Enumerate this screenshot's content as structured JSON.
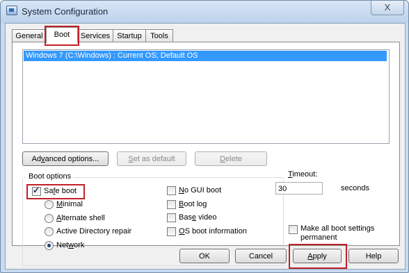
{
  "window": {
    "title": "System Configuration",
    "close_glyph": "X",
    "icon": "system-config-icon"
  },
  "tabs": [
    {
      "label": "General"
    },
    {
      "label": "Boot",
      "active": true
    },
    {
      "label": "Services"
    },
    {
      "label": "Startup"
    },
    {
      "label": "Tools"
    }
  ],
  "os_list": {
    "items": [
      "Windows 7 (C:\\Windows) : Current OS; Default OS"
    ],
    "selected_index": 0
  },
  "list_buttons": {
    "advanced_options": "Advanced options...",
    "set_default": "Set as default",
    "delete": "Delete"
  },
  "boot_options": {
    "label": "Boot options",
    "safe_boot": {
      "label": "Safe boot",
      "checked": true
    },
    "radios": {
      "minimal": "Minimal",
      "alternate_shell": "Alternate shell",
      "ad_repair": "Active Directory repair",
      "network": "Network",
      "selected": "Network"
    },
    "no_gui_boot": {
      "label": "No GUI boot",
      "checked": false
    },
    "boot_log": {
      "label": "Boot log",
      "checked": false
    },
    "base_video": {
      "label": "Base video",
      "checked": false
    },
    "os_boot_info": {
      "label": "OS boot information",
      "checked": false
    }
  },
  "timeout": {
    "label": "Timeout:",
    "value": "30",
    "unit": "seconds"
  },
  "permanent": {
    "label_line1": "Make all boot settings",
    "label_line2": "permanent",
    "checked": false
  },
  "dialog_buttons": {
    "ok": "OK",
    "cancel": "Cancel",
    "apply": "Apply",
    "help": "Help"
  },
  "colors": {
    "highlight": "#3399ff",
    "annotation_red": "#c0202a",
    "title_bar": "#c8daf0"
  }
}
